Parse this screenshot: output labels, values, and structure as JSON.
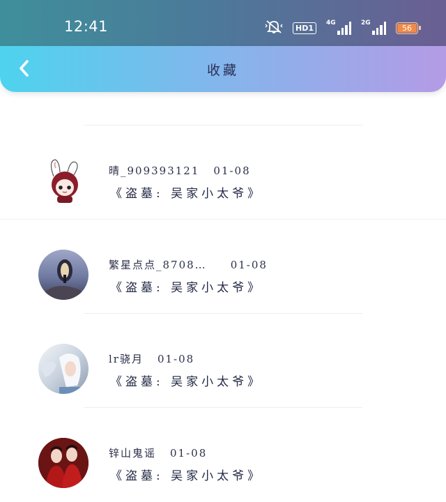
{
  "status_bar": {
    "time": "12:41",
    "hd_label": "HD1",
    "signal_1_label": "4G",
    "signal_2_label": "2G",
    "battery": "56",
    "icons": [
      "mute-bell-icon",
      "hd-icon",
      "signal-4g-icon",
      "signal-2g-icon",
      "battery-icon"
    ]
  },
  "header": {
    "title": "收藏",
    "back_icon": "chevron-left-icon"
  },
  "items": [
    {
      "username": "",
      "date": "",
      "work": ""
    },
    {
      "username": "晴_909393121",
      "date": "01-08",
      "work": "《盗墓: 吴家小太爷》"
    },
    {
      "username": "繁星点点_8708…",
      "date": "01-08",
      "work": "《盗墓: 吴家小太爷》"
    },
    {
      "username": "lr骁月",
      "date": "01-08",
      "work": "《盗墓: 吴家小太爷》"
    },
    {
      "username": "锌山鬼谣",
      "date": "01-08",
      "work": "《盗墓: 吴家小太爷》"
    }
  ],
  "colors": {
    "status_bar_left": "#3f8f9b",
    "status_bar_right": "#6a5f92",
    "header_left": "#4dd3ee",
    "header_right": "#b49be6",
    "battery": "#f08a4b"
  }
}
